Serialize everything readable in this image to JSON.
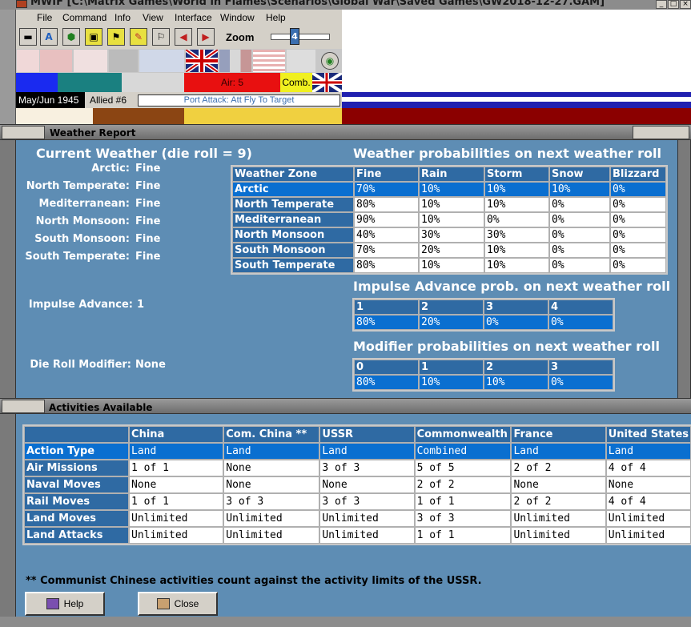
{
  "app": {
    "title": "MWIF [C:\\Matrix Games\\World in Flames\\Scenarios\\Global War\\Saved Games\\GW2018-12-27.GAM]"
  },
  "menu": [
    "File",
    "Command",
    "Info",
    "View",
    "Interface",
    "Window",
    "Help"
  ],
  "toolbar": {
    "zoom_label": "Zoom",
    "zoom_value": "4"
  },
  "statusbar": {
    "date": "May/Jun 1945",
    "side": "Allied #6",
    "message": "Port Attack: Att Fly To Target",
    "air_label": "Air: 5",
    "comb_label": "Comb."
  },
  "weather": {
    "panel_title": "Weather Report",
    "current_title": "Current Weather (die roll = 9)",
    "zones": [
      {
        "label": "Arctic:",
        "value": "Fine"
      },
      {
        "label": "North Temperate:",
        "value": "Fine"
      },
      {
        "label": "Mediterranean:",
        "value": "Fine"
      },
      {
        "label": "North Monsoon:",
        "value": "Fine"
      },
      {
        "label": "South Monsoon:",
        "value": "Fine"
      },
      {
        "label": "South Temperate:",
        "value": "Fine"
      }
    ],
    "impulse_label": "Impulse Advance:",
    "impulse_value": "1",
    "dieroll_label": "Die Roll Modifier:",
    "dieroll_value": "None",
    "prob_title": "Weather probabilities on next weather roll",
    "prob_headers": [
      "Weather Zone",
      "Fine",
      "Rain",
      "Storm",
      "Snow",
      "Blizzard"
    ],
    "prob_rows": [
      [
        "Arctic",
        "70%",
        "10%",
        "10%",
        "10%",
        "0%"
      ],
      [
        "North Temperate",
        "80%",
        "10%",
        "10%",
        "0%",
        "0%"
      ],
      [
        "Mediterranean",
        "90%",
        "10%",
        "0%",
        "0%",
        "0%"
      ],
      [
        "North Monsoon",
        "40%",
        "30%",
        "30%",
        "0%",
        "0%"
      ],
      [
        "South Monsoon",
        "70%",
        "20%",
        "10%",
        "0%",
        "0%"
      ],
      [
        "South Temperate",
        "80%",
        "10%",
        "10%",
        "0%",
        "0%"
      ]
    ],
    "impulse_title": "Impulse Advance prob. on next weather roll",
    "impulse_headers": [
      "1",
      "2",
      "3",
      "4"
    ],
    "impulse_row": [
      "80%",
      "20%",
      "0%",
      "0%"
    ],
    "modifier_title": "Modifier probabilities on next weather roll",
    "modifier_headers": [
      "0",
      "1",
      "2",
      "3"
    ],
    "modifier_row": [
      "80%",
      "10%",
      "10%",
      "0%"
    ]
  },
  "activities": {
    "panel_title": "Activities Available",
    "headers": [
      "",
      "China",
      "Com. China **",
      "USSR",
      "Commonwealth",
      "France",
      "United States"
    ],
    "rows": [
      [
        "Action Type",
        "Land",
        "Land",
        "Land",
        "Combined",
        "Land",
        "Land"
      ],
      [
        "Air Missions",
        "1 of 1",
        "None",
        "3 of 3",
        "5 of 5",
        "2 of 2",
        "4 of 4"
      ],
      [
        "Naval Moves",
        "None",
        "None",
        "None",
        "2 of 2",
        "None",
        "None"
      ],
      [
        "Rail Moves",
        "1 of 1",
        "3 of 3",
        "3 of 3",
        "1 of 1",
        "2 of 2",
        "4 of 4"
      ],
      [
        "Land Moves",
        "Unlimited",
        "Unlimited",
        "Unlimited",
        "3 of 3",
        "Unlimited",
        "Unlimited"
      ],
      [
        "Land Attacks",
        "Unlimited",
        "Unlimited",
        "Unlimited",
        "1 of 1",
        "Unlimited",
        "Unlimited"
      ]
    ],
    "footnote": "** Communist Chinese activities count against the activity limits of the USSR.",
    "help_label": "Help",
    "close_label": "Close"
  }
}
